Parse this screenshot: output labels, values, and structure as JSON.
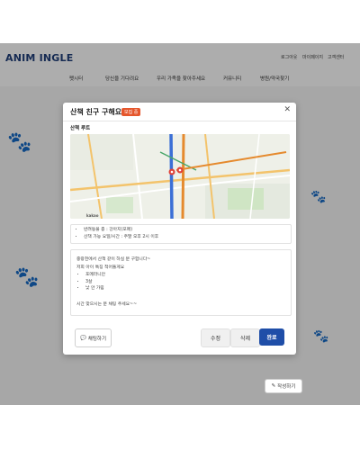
{
  "header": {
    "logo": "ANIM INGLE",
    "utility_links": [
      "로그아웃",
      "마이페이지",
      "고객센터"
    ]
  },
  "nav": [
    "펫시터",
    "당신을 기다려요",
    "우리 가족을 찾아주세요",
    "커뮤니티",
    "병원/약국찾기"
  ],
  "page": {
    "write_button": "작성하기"
  },
  "modal": {
    "title": "산책 친구 구해요~",
    "badge": "모집 중",
    "section_label": "산책 루트",
    "map_brand": "kakao",
    "info": [
      "반려동물 종 : 강아지(포메)",
      "산책 가능 요일/시간 : 주말 오후 2시 이후"
    ],
    "description": {
      "intro": "중랑천에서 산책 같이 하실 분 구합니다~",
      "sub": "저희 아이 특징 적어둘게요",
      "traits": [
        "포메라니안",
        "3살",
        "낯 안 가림"
      ],
      "outro": "시간 맞으시는 분 채팅 주세요~~"
    },
    "buttons": {
      "chat": "채팅하기",
      "edit": "수정",
      "delete": "삭제",
      "done": "완료"
    }
  }
}
